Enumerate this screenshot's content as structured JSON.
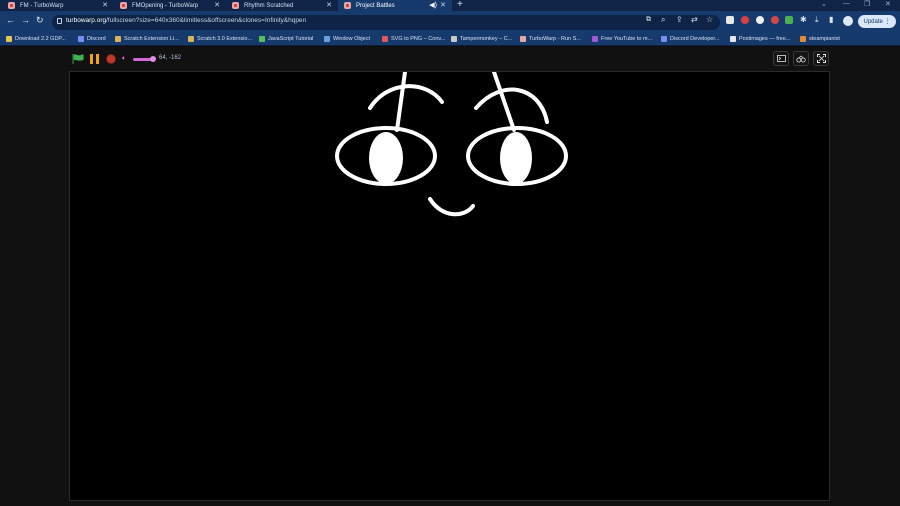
{
  "browser": {
    "tabs": [
      {
        "title": "FM - TurboWarp",
        "active": false
      },
      {
        "title": "FMOpening - TurboWarp",
        "active": false
      },
      {
        "title": "Rhythm Scratched",
        "active": false
      },
      {
        "title": "Project Battles",
        "active": true
      }
    ],
    "url_host": "turbowarp.org",
    "url_rest": "/fullscreen?size=640x360&limitless&offscreen&clones=Infinity&hqpen",
    "update_label": "Update",
    "bookmarks": [
      {
        "label": "Download 2.2 GDP...",
        "color": "#e0c64a"
      },
      {
        "label": "Discord",
        "color": "#7c8cf2"
      },
      {
        "label": "Scratch Extension Li...",
        "color": "#d9b35a"
      },
      {
        "label": "Scratch 3.0 Extensio...",
        "color": "#d9b35a"
      },
      {
        "label": "JavaScript Tutorial",
        "color": "#5bbf5b"
      },
      {
        "label": "Window Object",
        "color": "#6aa0e0"
      },
      {
        "label": "SVG to PNG – Conv...",
        "color": "#e05858"
      },
      {
        "label": "Tampermonkey – C...",
        "color": "#c9c9c9"
      },
      {
        "label": "TurboWarp - Run S...",
        "color": "#e9a6a6"
      },
      {
        "label": "Free YouTube to m...",
        "color": "#a05ad6"
      },
      {
        "label": "Discord Developer...",
        "color": "#7c8cf2"
      },
      {
        "label": "Postimages — free...",
        "color": "#e8e8e8"
      },
      {
        "label": "steampianist",
        "color": "#e08a3a"
      }
    ]
  },
  "player": {
    "mouse_coords": "64, -162"
  },
  "colors": {
    "accent_pink": "#d06ad6",
    "flag_green": "#3fb34f",
    "pause_orange": "#f4a11a",
    "stop_red": "#c0392b"
  }
}
